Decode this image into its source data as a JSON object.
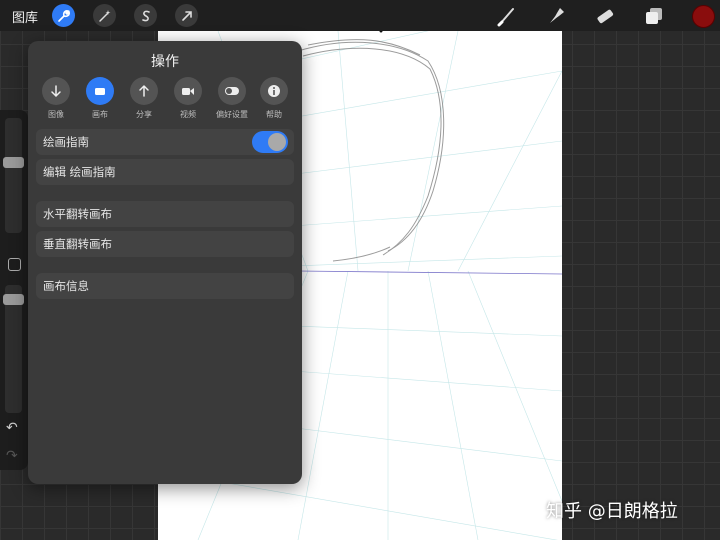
{
  "topbar": {
    "gallery_label": "图库",
    "tools_left": [
      {
        "icon": "wrench-icon",
        "active": true
      },
      {
        "icon": "magic-wand-icon",
        "active": false
      },
      {
        "icon": "selection-icon",
        "active": false
      },
      {
        "icon": "transform-arrow-icon",
        "active": false
      }
    ],
    "tools_right": [
      "brush-icon",
      "smudge-icon",
      "eraser-icon",
      "layers-icon"
    ],
    "current_color": "#8a0d0d"
  },
  "actions_panel": {
    "title": "操作",
    "tabs": [
      {
        "label": "图像",
        "icon": "arrow-down-icon",
        "active": false
      },
      {
        "label": "画布",
        "icon": "canvas-icon",
        "active": true
      },
      {
        "label": "分享",
        "icon": "arrow-up-icon",
        "active": false
      },
      {
        "label": "视频",
        "icon": "video-icon",
        "active": false
      },
      {
        "label": "偏好设置",
        "icon": "toggle-icon",
        "active": false
      },
      {
        "label": "帮助",
        "icon": "info-icon",
        "active": false
      }
    ],
    "drawing_guide_label": "绘画指南",
    "drawing_guide_on": true,
    "edit_guide_label": "编辑 绘画指南",
    "flip_h_label": "水平翻转画布",
    "flip_v_label": "垂直翻转画布",
    "canvas_info_label": "画布信息"
  },
  "accent_color": "#2f7bf5",
  "watermark": "知乎 @日朗格拉"
}
